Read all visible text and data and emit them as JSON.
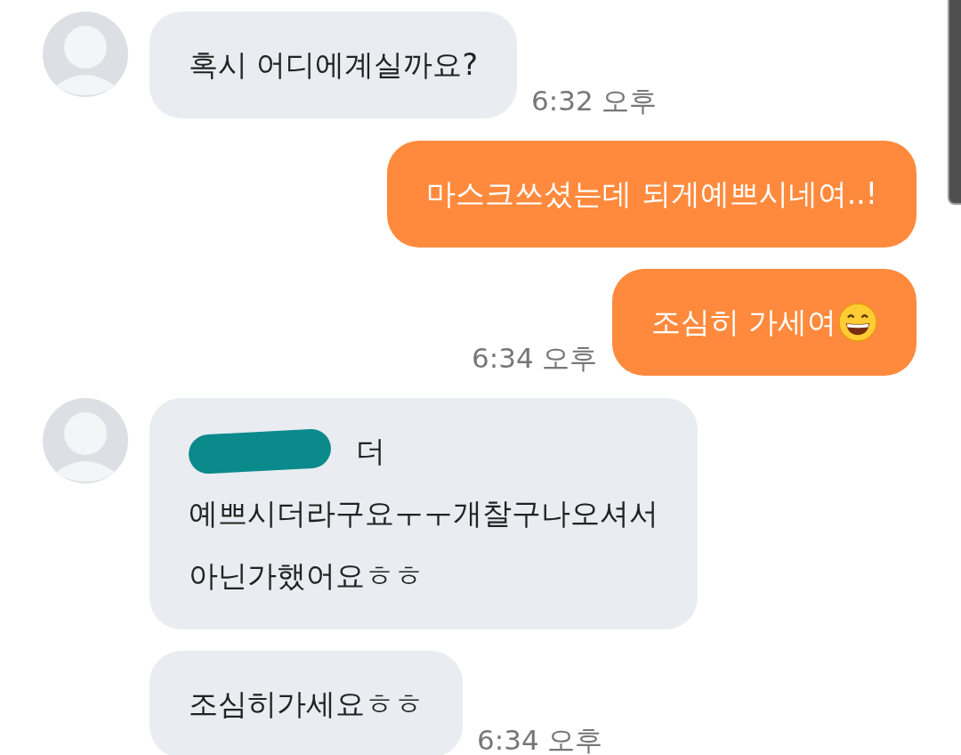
{
  "messages": [
    {
      "kind": "incoming",
      "show_avatar": true,
      "lines": [
        {
          "text": "혹시 어디에계실까요?",
          "redacted_prefix": false
        }
      ],
      "time": "6:32 오후"
    },
    {
      "kind": "outgoing",
      "lines": [
        {
          "text": "마스크쓰셨는데 되게예쁘시네여..!"
        }
      ],
      "emoji": false
    },
    {
      "kind": "outgoing",
      "lines": [
        {
          "text": "조심히 가세여"
        }
      ],
      "time": "6:34 오후",
      "emoji": true
    },
    {
      "kind": "incoming",
      "show_avatar": true,
      "lines": [
        {
          "text": "더",
          "redacted_prefix": true
        },
        {
          "text": "예쁘시더라구요ㅜㅜ개찰구나오셔서",
          "redacted_prefix": false
        },
        {
          "text": "아닌가했어요ㅎㅎ",
          "redacted_prefix": false
        }
      ]
    },
    {
      "kind": "incoming",
      "show_avatar": false,
      "lines": [
        {
          "text": "조심히가세요ㅎㅎ",
          "redacted_prefix": false
        }
      ],
      "time": "6:34 오후"
    }
  ]
}
